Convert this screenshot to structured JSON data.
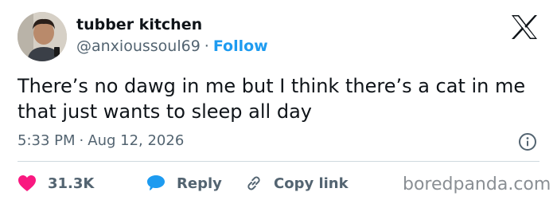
{
  "author": {
    "name": "tubber kitchen",
    "handle": "@anxioussoul69",
    "separator": "·",
    "follow_label": "Follow"
  },
  "tweet": {
    "text": "There’s no dawg in me but I think there’s a cat in me that just wants to sleep all day",
    "time": "5:33 PM",
    "separator": "·",
    "date": "Aug 12, 2026"
  },
  "actions": {
    "likes_count": "31.3K",
    "reply_label": "Reply",
    "copy_link_label": "Copy link"
  },
  "watermark": "boredpanda.com",
  "colors": {
    "like": "#f91880",
    "reply": "#1d9bf0",
    "follow": "#1d9bf0",
    "secondary_text": "#536471"
  },
  "icons": [
    "avatar",
    "x-logo-icon",
    "info-icon",
    "heart-icon",
    "reply-bubble-icon",
    "link-icon"
  ]
}
